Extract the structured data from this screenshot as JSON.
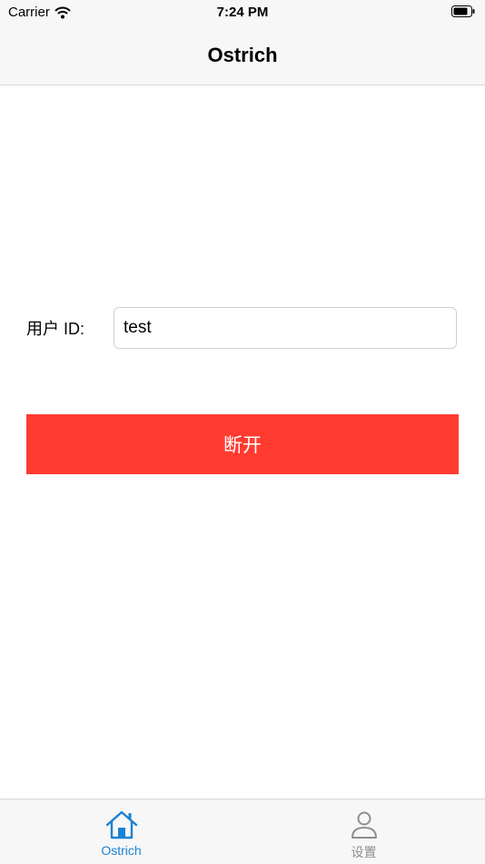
{
  "status_bar": {
    "carrier": "Carrier",
    "time": "7:24 PM"
  },
  "nav": {
    "title": "Ostrich"
  },
  "form": {
    "user_id_label": "用户 ID:",
    "user_id_value": "test"
  },
  "actions": {
    "disconnect_label": "断开"
  },
  "tabs": [
    {
      "label": "Ostrich",
      "icon": "home-icon",
      "active": true
    },
    {
      "label": "设置",
      "icon": "person-icon",
      "active": false
    }
  ],
  "colors": {
    "accent": "#1a82d4",
    "danger": "#ff3b30",
    "inactive": "#8e8e93",
    "bar_background": "#f7f7f7"
  }
}
